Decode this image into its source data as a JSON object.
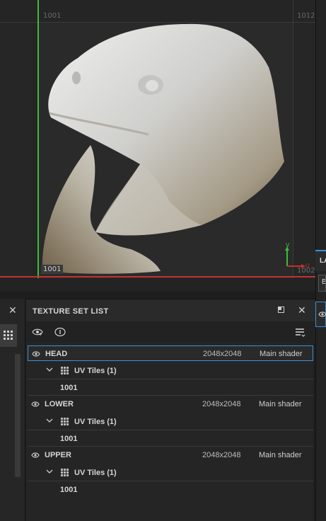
{
  "viewport": {
    "tile_1001_top": "1001",
    "tile_1012_top": "1012",
    "tile_1001_bottom": "1001",
    "tile_1002_bottom": "1002",
    "axis_y": "V",
    "axis_x": "U",
    "axis_x_color": "#c2322f",
    "axis_y_color": "#3dbb3d"
  },
  "right_dock": {
    "tab_label": "LA",
    "box_label": "B"
  },
  "texture_set_list": {
    "title": "TEXTURE SET LIST",
    "toolbar_icons": [
      "visibility-icon",
      "info-icon",
      "filter-menu-icon"
    ],
    "sets": [
      {
        "name": "HEAD",
        "resolution": "2048x2048",
        "shader": "Main shader",
        "selected": true,
        "tiles_label": "UV Tiles (1)",
        "tiles": [
          "1001"
        ]
      },
      {
        "name": "LOWER",
        "resolution": "2048x2048",
        "shader": "Main shader",
        "selected": false,
        "tiles_label": "UV Tiles (1)",
        "tiles": [
          "1001"
        ]
      },
      {
        "name": "UPPER",
        "resolution": "2048x2048",
        "shader": "Main shader",
        "selected": false,
        "tiles_label": "UV Tiles (1)",
        "tiles": [
          "1001"
        ]
      }
    ]
  },
  "colors": {
    "accent": "#3b8fd8",
    "panel_bg": "#252525",
    "text": "#d6d6d6"
  }
}
